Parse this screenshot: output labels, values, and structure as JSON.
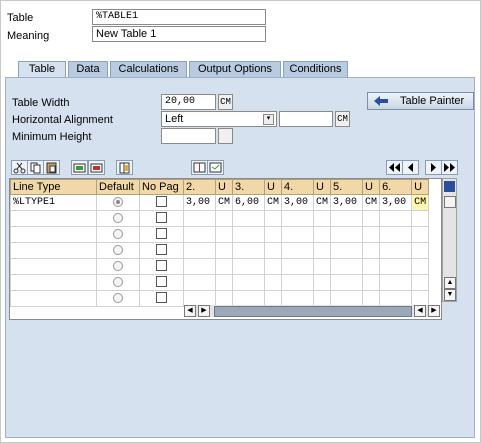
{
  "header": {
    "table_label": "Table",
    "table_value": "%TABLE1",
    "meaning_label": "Meaning",
    "meaning_value": "New Table 1"
  },
  "tabs": [
    {
      "label": "Table",
      "active": true
    },
    {
      "label": "Data"
    },
    {
      "label": "Calculations"
    },
    {
      "label": "Output Options"
    },
    {
      "label": "Conditions"
    }
  ],
  "form": {
    "width_label": "Table Width",
    "width_value": "20,00",
    "width_unit": "CM",
    "align_label": "Horizontal Alignment",
    "align_value": "Left",
    "align_unit": "CM",
    "minheight_label": "Minimum Height",
    "table_painter": "Table Painter"
  },
  "grid": {
    "columns": [
      "Line Type",
      "Default",
      "No Pag",
      "2.",
      "U",
      "3.",
      "U",
      "4.",
      "U",
      "5.",
      "U",
      "6.",
      "U"
    ],
    "rows": [
      {
        "line_type": "%LTYPE1",
        "default": true,
        "no_page": false,
        "values": [
          "3,00",
          "CM",
          "6,00",
          "CM",
          "3,00",
          "CM",
          "3,00",
          "CM",
          "3,00",
          "CM"
        ]
      }
    ],
    "empty_rows": 6
  },
  "icons": [
    "cut-icon",
    "copy-icon",
    "paste-icon",
    "insert-row-icon",
    "delete-row-icon",
    "insert-col-icon",
    "split-icon",
    "merge-icon",
    "first-page-icon",
    "prev-page-icon",
    "next-page-icon",
    "last-page-icon",
    "table-settings-icon",
    "arrow-left-icon"
  ]
}
